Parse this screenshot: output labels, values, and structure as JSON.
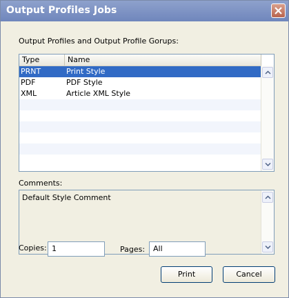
{
  "window": {
    "title": "Output Profiles Jobs"
  },
  "list": {
    "label": "Output Profiles and Output Profile Gorups:",
    "columns": [
      "Type",
      "Name"
    ],
    "rows": [
      {
        "type": "PRNT",
        "name": "Print Style",
        "selected": true
      },
      {
        "type": "PDF",
        "name": "PDF Style",
        "selected": false
      },
      {
        "type": "XML",
        "name": "Article XML Style",
        "selected": false
      }
    ]
  },
  "comments": {
    "label": "Comments:",
    "value": "Default Style Comment"
  },
  "copies": {
    "label": "Copies:",
    "value": "1"
  },
  "pages": {
    "label": "Pages:",
    "value": "All"
  },
  "buttons": {
    "print": "Print",
    "cancel": "Cancel"
  },
  "colors": {
    "titlebar": "#7f94c4",
    "selection": "#316ac5",
    "dialog_bg": "#f1efe2"
  },
  "icons": {
    "close": "close-icon",
    "scroll_up": "chevron-up-icon",
    "scroll_down": "chevron-down-icon"
  }
}
